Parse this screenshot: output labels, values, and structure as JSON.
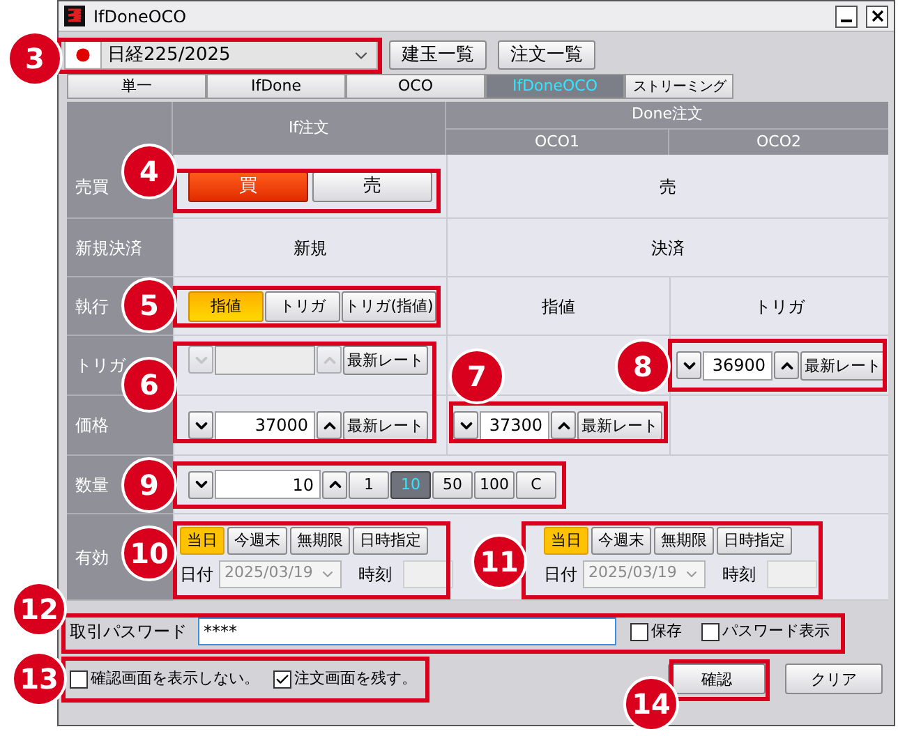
{
  "window": {
    "title": "IfDoneOCO"
  },
  "symbol": {
    "value": "日経225/2025"
  },
  "toolbar_buttons": [
    "建玉一覧",
    "注文一覧"
  ],
  "tabs": [
    {
      "label": "単一",
      "selected": false
    },
    {
      "label": "IfDone",
      "selected": false
    },
    {
      "label": "OCO",
      "selected": false
    },
    {
      "label": "IfDoneOCO",
      "selected": true
    },
    {
      "label": "ストリーミング",
      "selected": false
    }
  ],
  "headers": {
    "if": "If注文",
    "done": "Done注文",
    "oco1": "OCO1",
    "oco2": "OCO2"
  },
  "row_labels": [
    "売買",
    "新規決済",
    "執行",
    "トリガ",
    "価格",
    "数量",
    "有効"
  ],
  "side": {
    "buttons": [
      {
        "label": "買",
        "selected": true
      },
      {
        "label": "売",
        "selected": false
      }
    ],
    "done": "売"
  },
  "new_close": {
    "if": "新規",
    "done": "決済"
  },
  "execution": {
    "buttons": [
      {
        "label": "指値",
        "selected": true
      },
      {
        "label": "トリガ",
        "selected": false
      },
      {
        "label": "トリガ(指値)",
        "selected": false
      }
    ],
    "oco1": "指値",
    "oco2": "トリガ"
  },
  "trigger_price": {
    "if": {
      "disabled": true,
      "button": "最新レート"
    },
    "oco2": {
      "value": "36900",
      "disabled": false,
      "button": "最新レート"
    }
  },
  "price": {
    "if": {
      "value": "37000",
      "disabled": false,
      "button": "最新レート"
    },
    "oco1": {
      "value": "37300",
      "disabled": false,
      "button": "最新レート"
    }
  },
  "quantity": {
    "value": "10",
    "presets": [
      {
        "label": "1",
        "selected": false
      },
      {
        "label": "10",
        "selected": true
      },
      {
        "label": "50",
        "selected": false
      },
      {
        "label": "100",
        "selected": false
      },
      {
        "label": "C",
        "selected": false
      }
    ]
  },
  "expiry": [
    {
      "buttons": [
        {
          "label": "当日",
          "selected": true
        },
        {
          "label": "今週末",
          "selected": false
        },
        {
          "label": "無期限",
          "selected": false
        },
        {
          "label": "日時指定",
          "selected": false
        }
      ],
      "date_label": "日付",
      "date": "2025/03/19",
      "time_label": "時刻"
    },
    {
      "buttons": [
        {
          "label": "当日",
          "selected": true
        },
        {
          "label": "今週末",
          "selected": false
        },
        {
          "label": "無期限",
          "selected": false
        },
        {
          "label": "日時指定",
          "selected": false
        }
      ],
      "date_label": "日付",
      "date": "2025/03/19",
      "time_label": "時刻"
    }
  ],
  "password": {
    "label": "取引パスワード",
    "value": "****",
    "options": [
      {
        "label": "保存",
        "checked": false
      },
      {
        "label": "パスワード表示",
        "checked": false
      }
    ]
  },
  "bottom_options": [
    {
      "label": "確認画面を表示しない。",
      "checked": false
    },
    {
      "label": "注文画面を残す。",
      "checked": true
    }
  ],
  "actions": [
    "確認",
    "クリア"
  ],
  "callouts": [
    {
      "number": "3"
    },
    {
      "number": "4"
    },
    {
      "number": "5"
    },
    {
      "number": "6"
    },
    {
      "number": "7"
    },
    {
      "number": "8"
    },
    {
      "number": "9"
    },
    {
      "number": "10"
    },
    {
      "number": "11"
    },
    {
      "number": "12"
    },
    {
      "number": "13"
    },
    {
      "number": "14"
    }
  ]
}
